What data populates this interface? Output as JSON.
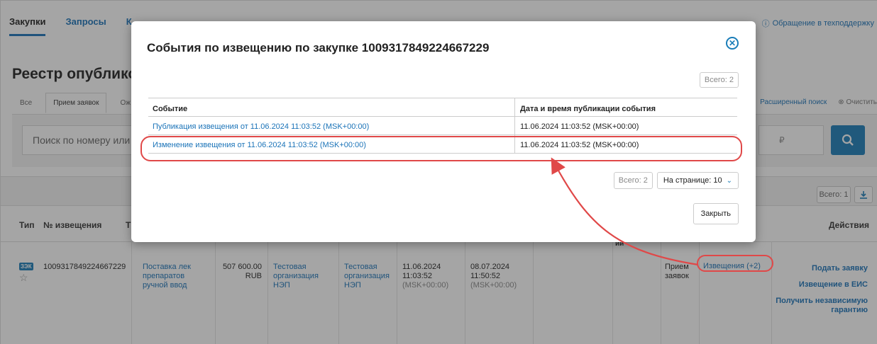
{
  "nav": {
    "tabs": [
      "Закупки",
      "Запросы",
      "К"
    ],
    "support": "Обращение в техподдержку"
  },
  "page_title": "Реестр опубликов",
  "filter_tabs": [
    "Все",
    "Прием заявок",
    "Ож"
  ],
  "advanced_search": "Расширенный поиск",
  "clear": "Очистить",
  "search_placeholder": "Поиск по номеру или к",
  "currency_symbol": "₽",
  "results_total": "Всего: 1",
  "table_headers": {
    "type": "Тип",
    "number": "№ извещения",
    "t": "Т",
    "actions": "Действия",
    "fragment": "ии"
  },
  "row": {
    "badge": "ЗЭК",
    "number": "1009317849224667229",
    "name": [
      "Поставка лек",
      "препаратов",
      "ручной ввод"
    ],
    "price": [
      "507 600.00",
      "RUB"
    ],
    "org1": [
      "Тестовая",
      "организация",
      "НЭП"
    ],
    "org2": [
      "Тестовая",
      "организация",
      "НЭП"
    ],
    "date1": [
      "11.06.2024",
      "11:03:52",
      "(MSK+00:00)"
    ],
    "date2": [
      "08.07.2024",
      "11:50:52",
      "(MSK+00:00)"
    ],
    "status": [
      "Прием",
      "заявок"
    ],
    "notices": "Извещения (+2)",
    "actions": [
      "Подать заявку",
      "Извещение в ЕИС",
      "Получить независимую гарантию"
    ]
  },
  "modal": {
    "title": "События по извещению по закупке 1009317849224667229",
    "total_top": "Всего: 2",
    "columns": [
      "Событие",
      "Дата и время публикации события"
    ],
    "rows": [
      {
        "event": "Публикация извещения от 11.06.2024 11:03:52 (MSK+00:00)",
        "datetime": "11.06.2024 11:03:52 (MSK+00:00)"
      },
      {
        "event": "Изменение извещения от 11.06.2024 11:03:52 (MSK+00:00)",
        "datetime": "11.06.2024 11:03:52 (MSK+00:00)"
      }
    ],
    "total_bottom": "Всего: 2",
    "per_page": "На странице: 10",
    "close_label": "Закрыть"
  },
  "colors": {
    "accent": "#1a73b8",
    "annotation": "#e04848"
  }
}
